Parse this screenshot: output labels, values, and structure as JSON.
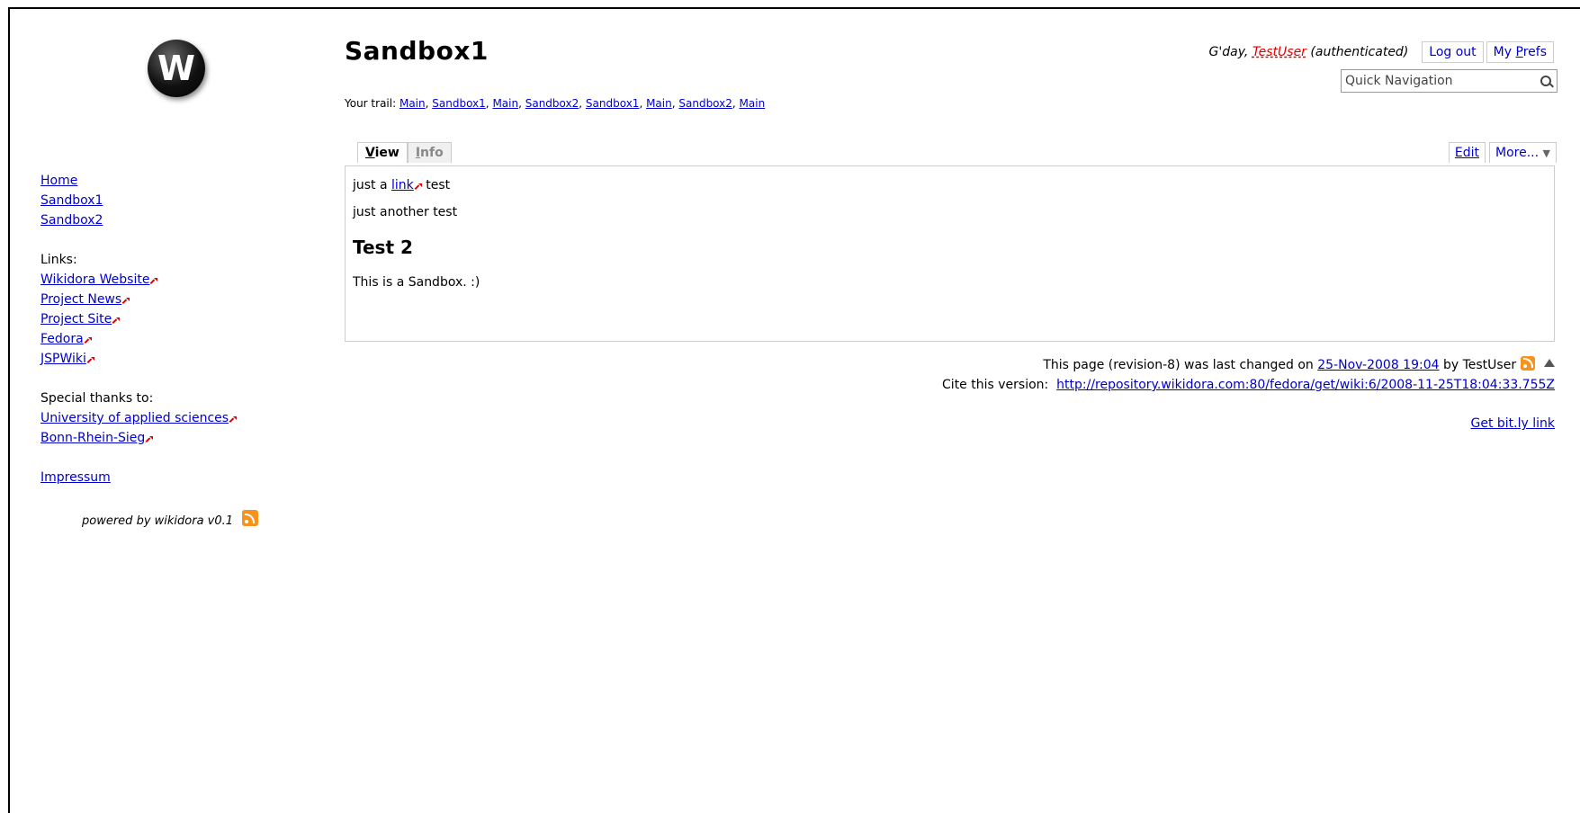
{
  "logo": {
    "letter": "W"
  },
  "sidebar": {
    "nav": [
      "Home",
      "Sandbox1",
      "Sandbox2"
    ],
    "links_label": "Links:",
    "links": [
      "Wikidora Website",
      "Project News",
      "Project Site",
      "Fedora",
      "JSPWiki"
    ],
    "thanks_label": "Special thanks to:",
    "thanks": [
      "University of applied sciences",
      "Bonn-Rhein-Sieg"
    ],
    "impressum": "Impressum",
    "powered": "powered by wikidora v0.1"
  },
  "header": {
    "title": "Sandbox1",
    "trail_label": "Your trail:",
    "trail": [
      "Main",
      "Sandbox1",
      "Main",
      "Sandbox2",
      "Sandbox1",
      "Main",
      "Sandbox2",
      "Main"
    ]
  },
  "user": {
    "greeting_prefix": "G'day,",
    "username": "TestUser",
    "status": "(authenticated)",
    "logout": "Log out",
    "prefs_prefix": "My ",
    "prefs_u": "P",
    "prefs_rest": "refs"
  },
  "search": {
    "placeholder": "Quick Navigation"
  },
  "tabs": {
    "view_u": "V",
    "view_rest": "iew",
    "info_u": "I",
    "info_rest": "nfo"
  },
  "actions": {
    "edit": "Edit",
    "more": "More...",
    "more_arrow": "▼"
  },
  "content": {
    "line1_pre": "just a",
    "line1_link": "link",
    "line1_post": "test",
    "line2": "just another test",
    "heading": "Test 2",
    "line3": "This is a Sandbox. :)"
  },
  "footer": {
    "changed_pre": "This page (revision-8) was last changed on",
    "changed_date": "25-Nov-2008 19:04",
    "changed_by": "by TestUser",
    "cite_label": "Cite this version:",
    "cite_url": "http://repository.wikidora.com:80/fedora/get/wiki:6/2008-11-25T18:04:33.755Z",
    "bitly": "Get bit.ly link"
  }
}
